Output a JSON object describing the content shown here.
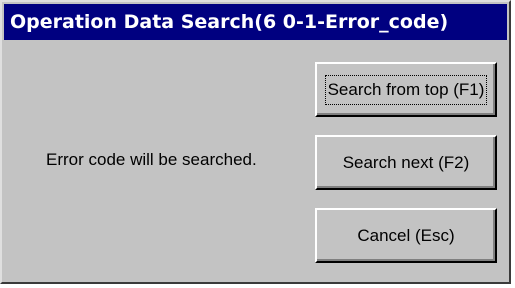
{
  "window": {
    "title": "Operation Data Search(6 0-1-Error_code)"
  },
  "message": "Error code will be searched.",
  "buttons": {
    "search_from_top": "Search from top (F1)",
    "search_next": "Search next (F2)",
    "cancel": "Cancel (Esc)"
  }
}
